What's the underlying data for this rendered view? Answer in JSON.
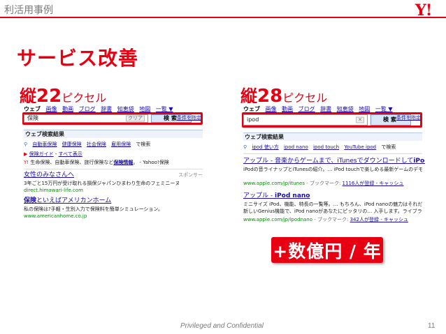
{
  "header": {
    "category": "利活用事例",
    "logo": "Y!"
  },
  "slide": {
    "title": "サービス改善"
  },
  "left": {
    "label": {
      "prefix": "縦",
      "number": "22",
      "unit": "ピクセル"
    },
    "tabs": {
      "web": "ウェブ",
      "image": "画像",
      "video": "動画",
      "blog": "ブログ",
      "dictionary": "辞書",
      "qa": "知恵袋",
      "map": "地図",
      "list_more": "一覧 ▼"
    },
    "query": "保険",
    "clear": "クリア",
    "search_button": "検索",
    "conditions": "条件を指定",
    "results_header": "ウェブ検索結果",
    "assist": {
      "items": [
        "自動車保険",
        "健康保険",
        "社会保険",
        "雇用保険"
      ],
      "suffix": "で検索"
    },
    "guide_line": {
      "a": "保険ガイド",
      "b": "すべて表示"
    },
    "life_line": {
      "text": "生命保険、自動車保険、旅行保険など",
      "link": "保険情報",
      "tail": "。 - Yahoo!保険"
    },
    "sponsor": "スポンサー",
    "ads": [
      {
        "title": "女性のみなさんへ",
        "desc": "3年ごと15万円が受け取れる損保ジャパンひまわり生命のフェミニーヌ",
        "url": "direct.himawari-life.com"
      },
      {
        "title_bold": "保険",
        "title_rest": "といえばアメリカンホーム",
        "desc": "私の保険は?手軽・生別入力で保険料を簡単シミュレーション。",
        "url": "www.americanhome.co.jp"
      }
    ]
  },
  "right": {
    "label": {
      "prefix": "縦",
      "number": "28",
      "unit": "ピクセル"
    },
    "tabs": {
      "web": "ウェブ",
      "image": "画像",
      "video": "動画",
      "blog": "ブログ",
      "dictionary": "辞書",
      "qa": "知恵袋",
      "map": "地図",
      "list_more": "一覧 ▼"
    },
    "query": "ipod",
    "clear": "×",
    "search_button": "検索",
    "conditions": "条件を指定",
    "results_header": "ウェブ検索結果",
    "assist": {
      "items": [
        "ipod 使い方",
        "ipod nano",
        "ipod touch",
        "YouTube ipod"
      ],
      "suffix": "で検索"
    },
    "results": [
      {
        "title_rest": "アップル - 音楽からゲームまで、iTunesでダウンロードして",
        "title_bold": "iPod",
        "title_tail": "...",
        "desc1": "iPodの音ライナップとiTunesの紹介。… iPod touchで楽しめる最新ゲームのデモ…ビーをチェ",
        "desc2": "",
        "url": "www.apple.com/jp/itunes",
        "meta": " - ブックマーク: ",
        "bm": "1116人が登録",
        "cache": " - キャッシュ"
      },
      {
        "title_rest": "アップル - ",
        "title_bold": "iPod nano",
        "title_tail": "",
        "desc1": "ミニサイズ iPod、機能、特長の一覧等。… もちろん、iPod nanoの魅力はそれだけではありませ",
        "desc2": "新しいGenius機能で、iPod nanoがあなたにピッタリの… 入手します。ライブラリにある曲から",
        "url": "www.apple.com/jp/ipodnano",
        "meta": " - ブックマーク: ",
        "bm": "342人が登録",
        "cache": " - キャッシュ"
      }
    ]
  },
  "badge": "+数億円 / 年",
  "footer": {
    "text": "Privileged and Confidential",
    "page": "11"
  }
}
